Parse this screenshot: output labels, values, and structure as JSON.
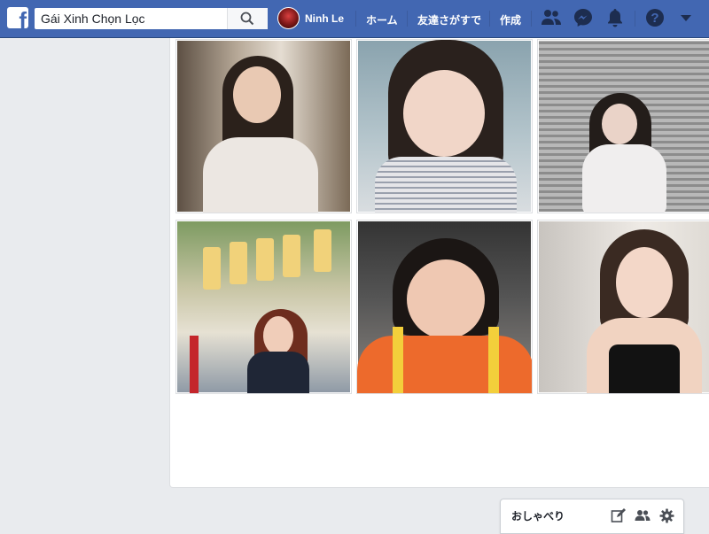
{
  "header": {
    "search": {
      "value": "Gái Xinh Chọn Lọc",
      "placeholder": ""
    },
    "profile_name": "Ninh Le",
    "home_label": "ホーム",
    "find_friends_label": "友達さがすで",
    "create_label": "作成",
    "brand_color": "#4267b2"
  },
  "photos": [
    {
      "label": "photo-1",
      "palette": [
        "#8a7a66",
        "#d8d0c4"
      ]
    },
    {
      "label": "photo-2",
      "palette": [
        "#7f9aa8",
        "#c7d6de"
      ]
    },
    {
      "label": "photo-3",
      "palette": [
        "#5a5a5a",
        "#a9a9a9"
      ]
    },
    {
      "label": "photo-4",
      "palette": [
        "#6f8a56",
        "#e8d9a2"
      ]
    },
    {
      "label": "photo-5",
      "palette": [
        "#3d3b38",
        "#e86a2e"
      ]
    },
    {
      "label": "photo-6",
      "palette": [
        "#cfcac4",
        "#f3efe9"
      ]
    }
  ],
  "chat": {
    "title": "おしゃべり",
    "icons": [
      "compose-icon",
      "group-chat-icon",
      "settings-gear-icon"
    ]
  }
}
